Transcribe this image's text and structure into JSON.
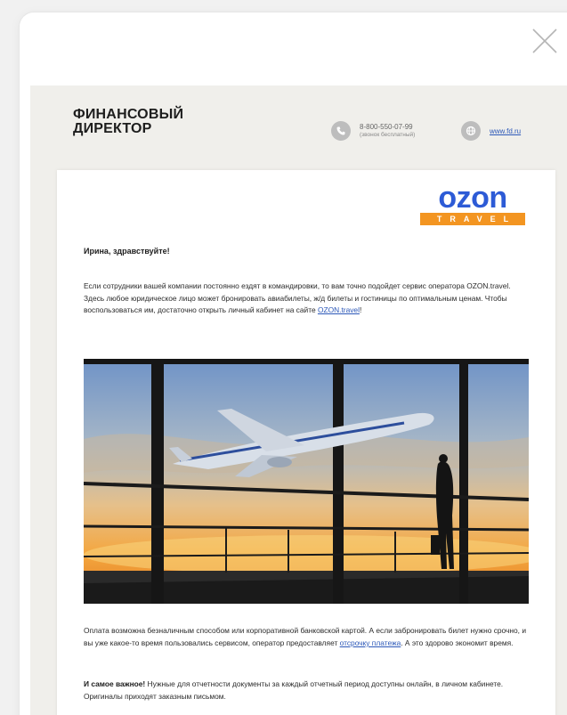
{
  "modal": {
    "close_icon": "close-icon"
  },
  "header": {
    "brand_line1": "ФИНАНСОВЫЙ",
    "brand_line2": "ДИРЕКТОР",
    "phone_number": "8-800-550-07-99",
    "phone_note": "(звонок бесплатный)",
    "phone_icon": "phone-icon",
    "site_icon": "globe-icon",
    "site_link": "www.fd.ru"
  },
  "email": {
    "logo_word": "ozon",
    "logo_sub": "TRAVEL",
    "greeting": "Ирина, здравствуйте!",
    "intro_text": "Если сотрудники вашей компании постоянно ездят в командировки, то вам точно подойдет сервис оператора OZON.travel. Здесь любое юридическое лицо может бронировать авиабилеты, ж/д билеты и гостиницы по оптимальным ценам. Чтобы воспользоваться им, достаточно открыть личный кабинет на сайте",
    "intro_link": "OZON.travel",
    "intro_end": "!",
    "hero_image": "airport-window-airplane-image",
    "pay_text_1": "Оплата возможна безналичным способом или корпоративной банковской картой. А если забронировать билет нужно срочно, и вы уже какое-то время пользовались сервисом, оператор предоставляет",
    "pay_link": "отсрочку платежа",
    "pay_text_2": ". А это здорово экономит время.",
    "docs_bold": "И самое важное!",
    "docs_text": " Нужные для отчетности документы за каждый отчетный период доступны онлайн, в личном кабинете. Оригиналы приходят заказным письмом."
  },
  "colors": {
    "ozon_blue": "#2d5bd6",
    "travel_orange": "#f39521",
    "link_blue": "#2c58b8",
    "page_bg": "#f0efeb"
  }
}
